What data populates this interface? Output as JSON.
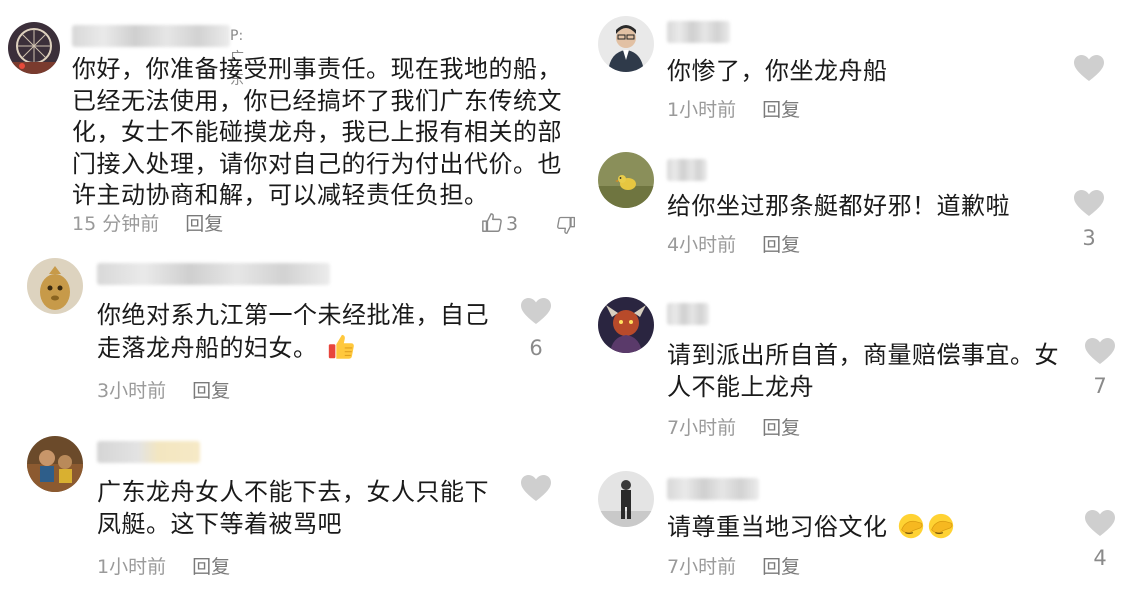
{
  "left": {
    "comments": [
      {
        "username_suffix": "P:广东",
        "text": "你好，你准备接受刑事责任。现在我地的船，已经无法使用，你已经搞坏了我们广东传统文化，女士不能碰摸龙舟，我已上报有相关的部门接入处理，请你对自己的行为付出代价。也许主动协商和解，可以减轻责任负担。",
        "time": "15 分钟前",
        "reply": "回复",
        "thumbs_up_count": "3"
      },
      {
        "text": "你绝对系九江第一个未经批准，自己走落龙舟船的妇女。",
        "time": "3小时前",
        "reply": "回复",
        "likes": "6"
      },
      {
        "text": "广东龙舟女人不能下去，女人只能下凤艇。这下等着被骂吧",
        "time": "1小时前",
        "reply": "回复",
        "likes": ""
      }
    ]
  },
  "right": {
    "comments": [
      {
        "text": "你惨了，你坐龙舟船",
        "time": "1小时前",
        "reply": "回复",
        "likes": ""
      },
      {
        "text": "给你坐过那条艇都好邪！道歉啦",
        "time": "4小时前",
        "reply": "回复",
        "likes": "3"
      },
      {
        "text": "请到派出所自首，商量赔偿事宜。女人不能上龙舟",
        "time": "7小时前",
        "reply": "回复",
        "likes": "7"
      },
      {
        "text": "请尊重当地习俗文化",
        "time": "7小时前",
        "reply": "回复",
        "likes": "4"
      }
    ]
  },
  "icons": {
    "like": "heart-icon",
    "thumbs_up": "thumbs-up-icon",
    "thumbs_down": "thumbs-down-icon",
    "emoji_thumbs_up": "thumbs-up-emoji",
    "emoji_facepalm": "facepalm-emoji"
  },
  "colors": {
    "heart": "#cfcfcf",
    "meta": "#9a9a9a",
    "text": "#1a1a1a"
  }
}
